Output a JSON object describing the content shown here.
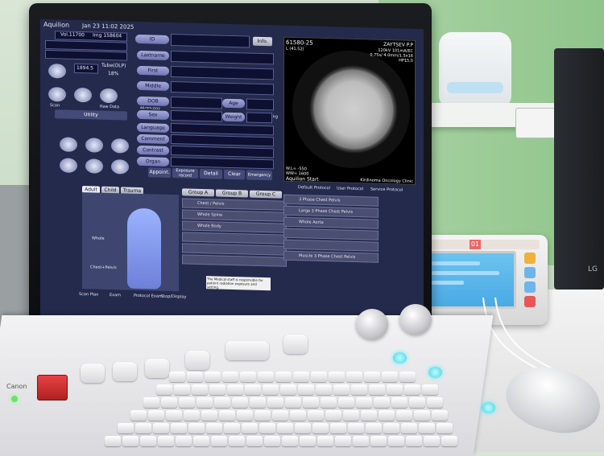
{
  "scanner": {
    "brand": "Aquilion",
    "datetime": "Jan 23 11:02 2025",
    "vol": "Vol.11700",
    "img": "Img 158604",
    "value_1": "1894.5",
    "tube_label": "Tube(OLP)",
    "tube_pct": "18%",
    "utility_label": "Utility",
    "scan_label": "Scan",
    "recon_label": "Raw Data"
  },
  "patient": {
    "labels": [
      "ID",
      "Lastname",
      "First",
      "Middle",
      "DOB",
      "Sex",
      "Language",
      "Comment",
      "Contrast",
      "Organ"
    ],
    "info_button": "Info.",
    "age_label": "Age",
    "weight_label": "Weight",
    "weight_unit": "kg",
    "dob_value": "dd.mm.yyyy",
    "buttons": [
      "Appoint.",
      "Exposure record",
      "Detail",
      "Clear",
      "Emergency"
    ]
  },
  "image_panel": {
    "study": "61580-25",
    "slice": "L (41.52)",
    "patient_name": "ZAYTSEV P.P",
    "kv_line": "120kV 101mA/EC",
    "params": "0.75s/ 4.0mm/1.5x16",
    "hp": "HP15.0",
    "wl": "W.L= -550",
    "ww": "WW= 1600",
    "start": "Aquilion Start",
    "institute": "Kirdinoma Oncology Clinic"
  },
  "protocol": {
    "tabs": [
      "Adult",
      "Child",
      "Trauma"
    ],
    "radio": [
      "Default Protocol",
      "User Protocol",
      "Service Protocol"
    ],
    "groups": [
      "Group A",
      "Group B",
      "Group C"
    ],
    "left_items": [
      "Chest / Pelvis",
      "Whole Spine",
      "Whole Body"
    ],
    "right_items": [
      "3 Phase Chest Pelvis",
      "Large 3 Phase Chest Pelvis",
      "Whole Aorta",
      "Muscle 3 Phase Chest Pelvis"
    ],
    "body_labels": [
      "Whole",
      "Chest+Pelvis"
    ],
    "notice": "The Medical staff is responsible for patient radiation exposure and setting."
  },
  "bottom_bar": [
    "Scan Plan",
    "Exam",
    "Protocol Exam",
    "Stop/Display"
  ],
  "keyboard": {
    "brand": "Canon"
  },
  "injector": {
    "top_label": "01"
  },
  "other": {
    "tower_brand": "LG"
  }
}
